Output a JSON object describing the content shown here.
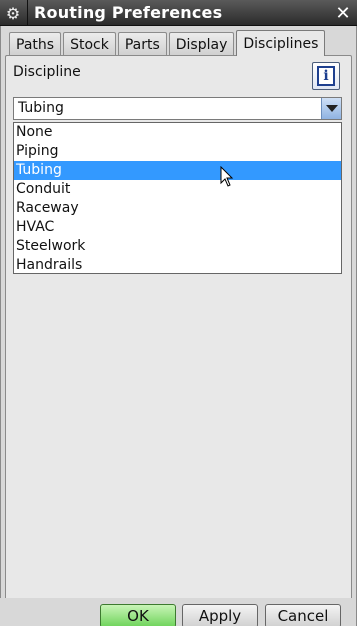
{
  "window": {
    "title": "Routing Preferences",
    "settings_icon": "gear-icon",
    "close_icon": "close-icon"
  },
  "tabs": [
    {
      "label": "Paths",
      "active": false
    },
    {
      "label": "Stock",
      "active": false
    },
    {
      "label": "Parts",
      "active": false
    },
    {
      "label": "Display",
      "active": false
    },
    {
      "label": "Disciplines",
      "active": true
    }
  ],
  "discipline": {
    "label": "Discipline",
    "info_icon": "info-icon",
    "selected_value": "Tubing",
    "options": [
      "None",
      "Piping",
      "Tubing",
      "Conduit",
      "Raceway",
      "HVAC",
      "Steelwork",
      "Handrails"
    ],
    "highlighted_option": "Tubing"
  },
  "buttons": {
    "ok": "OK",
    "apply": "Apply",
    "cancel": "Cancel"
  },
  "colors": {
    "highlight": "#3399ff",
    "ok_button": "#6ed35a",
    "titlebar": "#2b2b2b"
  }
}
